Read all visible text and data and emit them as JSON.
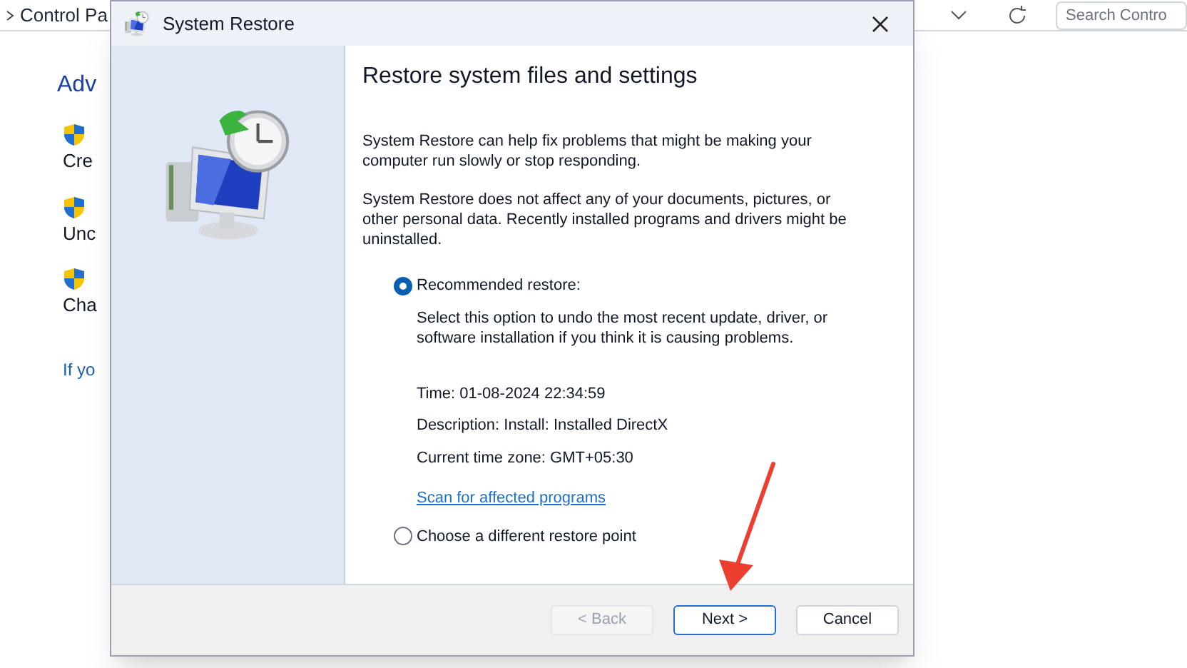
{
  "background_window": {
    "breadcrumb": "Control Pa",
    "search": {
      "placeholder": "Search Contro"
    },
    "heading": "Adv",
    "tasks": [
      {
        "label": "Cre"
      },
      {
        "label": "Unc"
      },
      {
        "label": "Cha"
      }
    ],
    "link": "If yo"
  },
  "dialog": {
    "title": "System Restore",
    "heading": "Restore system files and settings",
    "paragraphs": [
      "System Restore can help fix problems that might be making your computer run slowly or stop responding.",
      "System Restore does not affect any of your documents, pictures, or other personal data. Recently installed programs and drivers might be uninstalled."
    ],
    "options": [
      {
        "label": "Recommended restore:",
        "selected": true,
        "description": "Select this option to undo the most recent update, driver, or software installation if you think it is causing problems.",
        "details": [
          "Time: 01-08-2024 22:34:59",
          "Description: Install: Installed DirectX",
          "Current time zone: GMT+05:30"
        ],
        "link": "Scan for affected programs"
      },
      {
        "label": "Choose a different restore point",
        "selected": false
      }
    ],
    "buttons": [
      {
        "label": "< Back",
        "disabled": true,
        "focused": false
      },
      {
        "label": "Next >",
        "disabled": false,
        "focused": true
      },
      {
        "label": "Cancel",
        "disabled": false,
        "focused": false
      }
    ]
  }
}
